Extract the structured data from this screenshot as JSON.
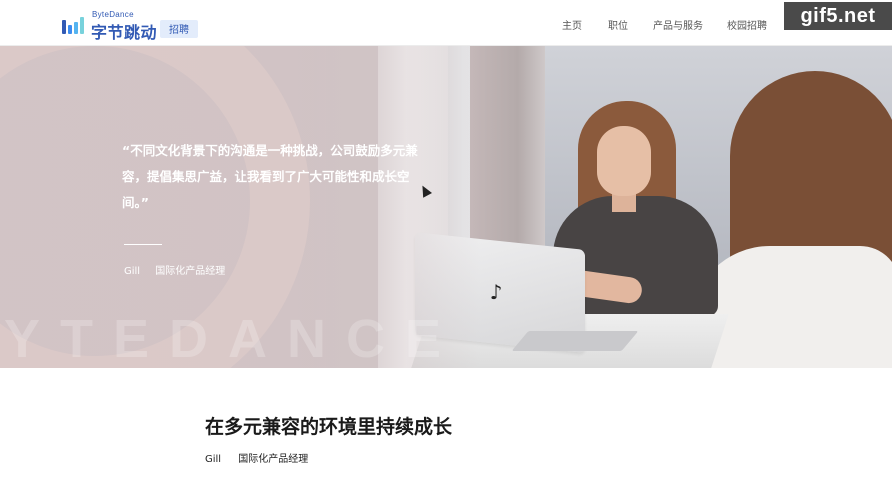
{
  "header": {
    "logo": {
      "en": "ByteDance",
      "cn": "字节跳动",
      "tag": "招聘",
      "mark_colors": [
        "#325ab4",
        "#3c8cf0",
        "#55b4f0",
        "#78d2dc"
      ]
    },
    "nav": [
      {
        "label": "主页",
        "name": "nav-home"
      },
      {
        "label": "职位",
        "name": "nav-jobs"
      },
      {
        "label": "产品与服务",
        "name": "nav-products"
      },
      {
        "label": "校园招聘",
        "name": "nav-campus"
      }
    ],
    "watermark": "gif5.net"
  },
  "hero": {
    "quote": "“不同文化背景下的沟通是一种挑战，公司鼓励多元兼容，提倡集思广益，让我看到了广大可能性和成长空间。”",
    "author_name": "Gill",
    "author_title": "国际化产品经理",
    "background_text": "YTEDANCE",
    "laptop_icon": "tiktok-note-icon",
    "laptop_glyph": "♪"
  },
  "section": {
    "title": "在多元兼容的环境里持续成长",
    "author_name": "Gill",
    "author_title": "国际化产品经理"
  },
  "colors": {
    "brand": "#325ab4",
    "tag_bg": "#e3ecfb"
  }
}
